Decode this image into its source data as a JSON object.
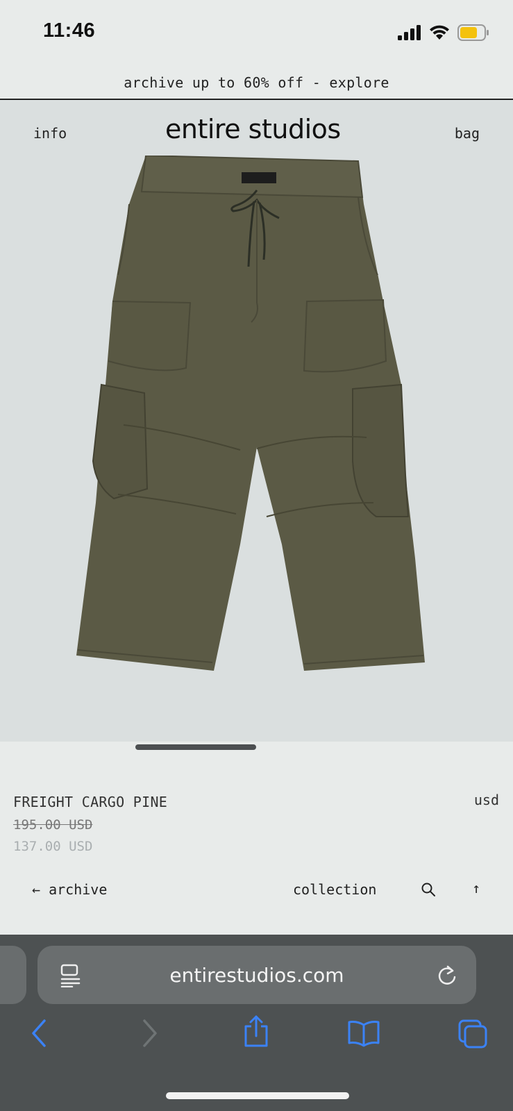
{
  "status_bar": {
    "time": "11:46"
  },
  "promo": {
    "text": "archive up to 60% off - explore"
  },
  "site_header": {
    "info": "info",
    "logo": "entire studios",
    "bag": "bag"
  },
  "product": {
    "name": "FREIGHT CARGO PINE",
    "currency": "usd",
    "price_original": "195.00 USD",
    "price_sale": "137.00 USD",
    "color": "#5a5a44"
  },
  "footer_nav": {
    "back": "← archive",
    "collection": "collection",
    "top": "↑"
  },
  "browser": {
    "url": "entirestudios.com",
    "accent": "#3b82f6"
  }
}
